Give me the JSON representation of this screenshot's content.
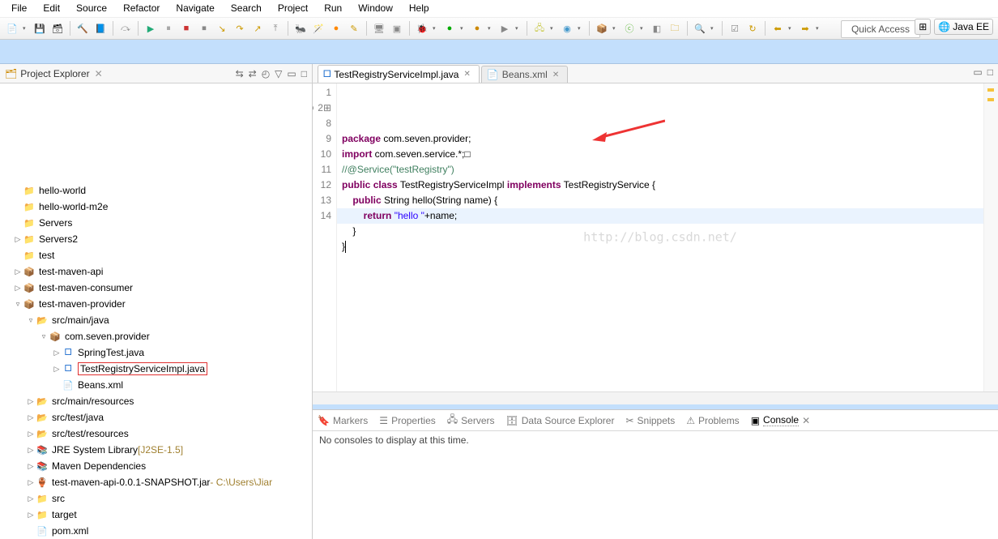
{
  "menu": [
    "File",
    "Edit",
    "Source",
    "Refactor",
    "Navigate",
    "Search",
    "Project",
    "Run",
    "Window",
    "Help"
  ],
  "quick_access": "Quick Access",
  "perspective": "Java EE",
  "explorer": {
    "title": "Project Explorer",
    "tree": [
      {
        "d": 1,
        "arrow": "",
        "icon": "📁",
        "label": "hello-world"
      },
      {
        "d": 1,
        "arrow": "",
        "icon": "📁",
        "label": "hello-world-m2e"
      },
      {
        "d": 1,
        "arrow": "",
        "icon": "📁",
        "label": "Servers"
      },
      {
        "d": 1,
        "arrow": "▷",
        "icon": "📁",
        "label": "Servers2"
      },
      {
        "d": 1,
        "arrow": "",
        "icon": "📁",
        "label": "test"
      },
      {
        "d": 1,
        "arrow": "▷",
        "icon": "📦",
        "label": "test-maven-api"
      },
      {
        "d": 1,
        "arrow": "▷",
        "icon": "📦",
        "label": "test-maven-consumer"
      },
      {
        "d": 1,
        "arrow": "▿",
        "icon": "📦",
        "label": "test-maven-provider"
      },
      {
        "d": 2,
        "arrow": "▿",
        "icon": "📂",
        "label": "src/main/java"
      },
      {
        "d": 3,
        "arrow": "▿",
        "icon": "📦",
        "label": "com.seven.provider"
      },
      {
        "d": 4,
        "arrow": "▷",
        "icon": "J",
        "label": "SpringTest.java"
      },
      {
        "d": 4,
        "arrow": "▷",
        "icon": "J",
        "label": "TestRegistryServiceImpl.java",
        "red": true
      },
      {
        "d": 4,
        "arrow": "",
        "icon": "X",
        "label": "Beans.xml"
      },
      {
        "d": 2,
        "arrow": "▷",
        "icon": "📂",
        "label": "src/main/resources"
      },
      {
        "d": 2,
        "arrow": "▷",
        "icon": "📂",
        "label": "src/test/java"
      },
      {
        "d": 2,
        "arrow": "▷",
        "icon": "📂",
        "label": "src/test/resources"
      },
      {
        "d": 2,
        "arrow": "▷",
        "icon": "📚",
        "label": "JRE System Library",
        "suffix": "[J2SE-1.5]"
      },
      {
        "d": 2,
        "arrow": "▷",
        "icon": "📚",
        "label": "Maven Dependencies"
      },
      {
        "d": 2,
        "arrow": "▷",
        "icon": "🏺",
        "label": "test-maven-api-0.0.1-SNAPSHOT.jar",
        "suffix": "- C:\\Users\\Jiar"
      },
      {
        "d": 2,
        "arrow": "▷",
        "icon": "📁",
        "label": "src"
      },
      {
        "d": 2,
        "arrow": "▷",
        "icon": "📁",
        "label": "target"
      },
      {
        "d": 2,
        "arrow": "",
        "icon": "📄",
        "label": "pom.xml"
      }
    ]
  },
  "editor": {
    "tabs": [
      {
        "label": "TestRegistryServiceImpl.java",
        "active": true,
        "icon": "J"
      },
      {
        "label": "Beans.xml",
        "active": false,
        "icon": "X"
      }
    ],
    "code_lines": [
      {
        "n": "1",
        "html": "<span class='kw'>package</span> com.seven.provider;"
      },
      {
        "n": "2",
        "mark": "plus",
        "html": "<span class='kw'>import</span> com.seven.service.*;□"
      },
      {
        "n": "8",
        "html": "<span class='cmt'>//@Service(\"testRegistry\")</span>"
      },
      {
        "n": "9",
        "html": "<span class='kw'>public</span> <span class='kw'>class</span> TestRegistryServiceImpl <span class='kw'>implements</span> TestRegistryService {"
      },
      {
        "n": "10",
        "mark": "warn",
        "html": "    <span class='kw'>public</span> String hello(String name) {"
      },
      {
        "n": "11",
        "html": "        <span class='kw'>return</span> <span class='str'>\"hello \"</span>+name;"
      },
      {
        "n": "12",
        "html": "    }"
      },
      {
        "n": "13",
        "html": ""
      },
      {
        "n": "14",
        "html": "}<span class='caret'></span>",
        "cursor": true
      }
    ],
    "watermark": "http://blog.csdn.net/"
  },
  "bottom": {
    "tabs": [
      "Markers",
      "Properties",
      "Servers",
      "Data Source Explorer",
      "Snippets",
      "Problems",
      "Console"
    ],
    "active": "Console",
    "body": "No consoles to display at this time."
  }
}
